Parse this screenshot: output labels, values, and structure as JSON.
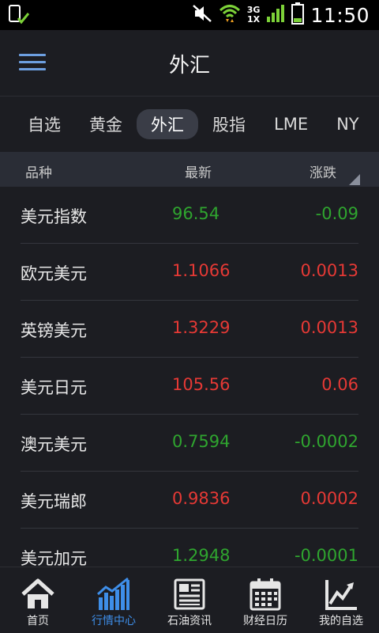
{
  "status_bar": {
    "time": "11:50",
    "network_top": "3G",
    "network_bottom": "1X",
    "icons": [
      "screenshot-icon",
      "mute-icon",
      "wifi-icon",
      "signal-icon",
      "battery-icon"
    ]
  },
  "header": {
    "title": "外汇",
    "menu_icon": "hamburger-menu-icon"
  },
  "tabs": [
    {
      "label": "自选",
      "active": false
    },
    {
      "label": "黄金",
      "active": false
    },
    {
      "label": "外汇",
      "active": true
    },
    {
      "label": "股指",
      "active": false
    },
    {
      "label": "LME",
      "active": false
    },
    {
      "label": "NY",
      "active": false
    }
  ],
  "table": {
    "headers": {
      "name": "品种",
      "last": "最新",
      "change": "涨跌"
    },
    "rows": [
      {
        "name": "美元指数",
        "last": "96.54",
        "change": "-0.09",
        "trend": "down"
      },
      {
        "name": "欧元美元",
        "last": "1.1066",
        "change": "0.0013",
        "trend": "up"
      },
      {
        "name": "英镑美元",
        "last": "1.3229",
        "change": "0.0013",
        "trend": "up"
      },
      {
        "name": "美元日元",
        "last": "105.56",
        "change": "0.06",
        "trend": "up"
      },
      {
        "name": "澳元美元",
        "last": "0.7594",
        "change": "-0.0002",
        "trend": "down"
      },
      {
        "name": "美元瑞郎",
        "last": "0.9836",
        "change": "0.0002",
        "trend": "up"
      },
      {
        "name": "美元加元",
        "last": "1.2948",
        "change": "-0.0001",
        "trend": "down"
      }
    ]
  },
  "bottom_nav": {
    "items": [
      {
        "label": "首页",
        "icon": "home-icon",
        "active": false
      },
      {
        "label": "行情中心",
        "icon": "market-chart-icon",
        "active": true
      },
      {
        "label": "石油资讯",
        "icon": "newspaper-icon",
        "active": false
      },
      {
        "label": "财经日历",
        "icon": "calendar-icon",
        "active": false
      },
      {
        "label": "我的自选",
        "icon": "trend-line-icon",
        "active": false
      }
    ]
  },
  "colors": {
    "up": "#e53935",
    "down": "#2fa52f",
    "accent": "#3e8ee8",
    "background": "#1c1d22"
  }
}
